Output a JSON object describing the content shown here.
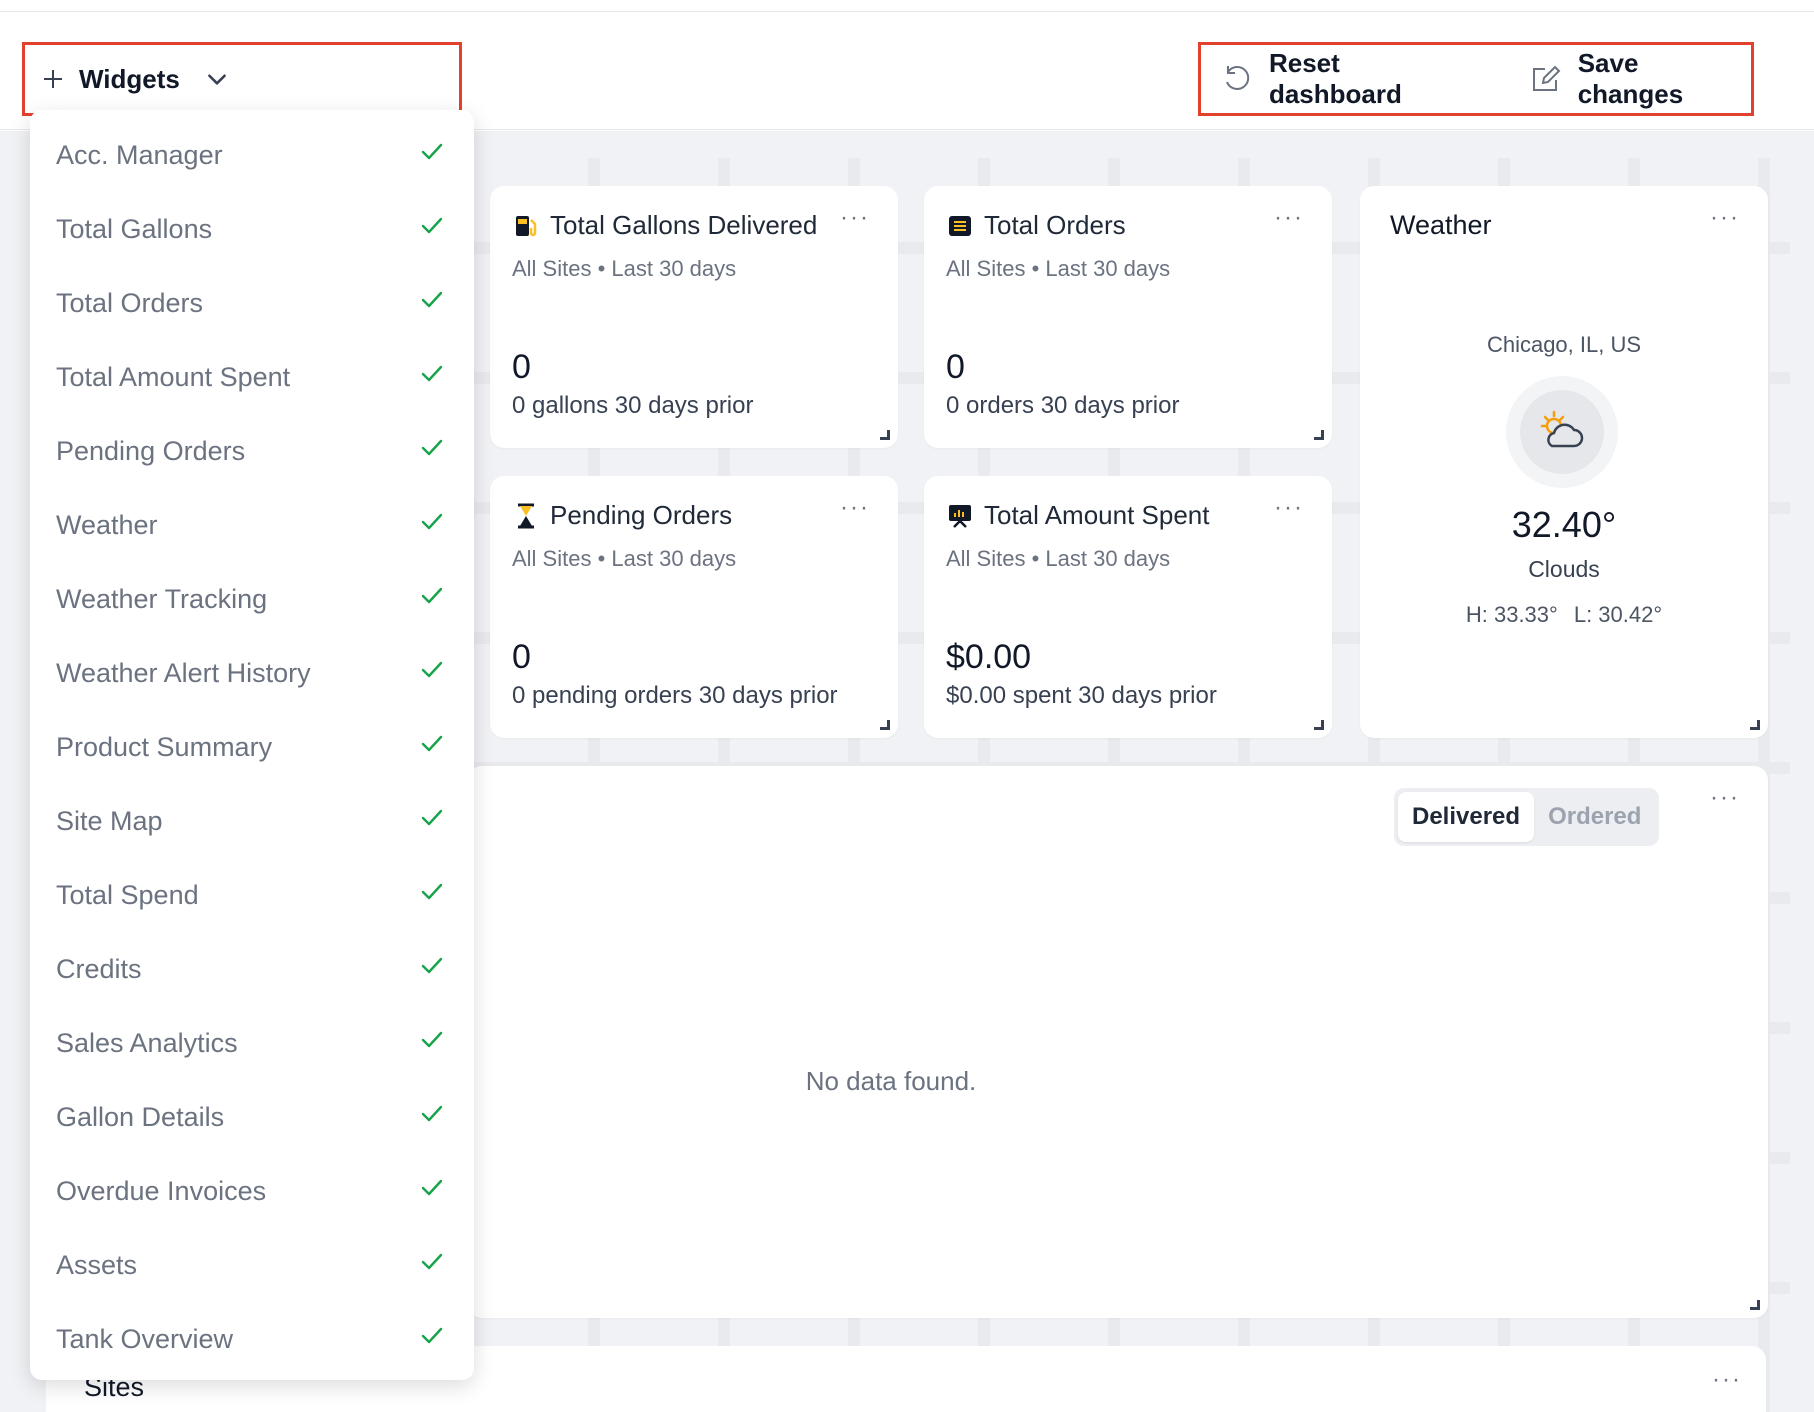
{
  "toolbar": {
    "widgets_label": "Widgets",
    "reset_label": "Reset dashboard",
    "save_label": "Save changes"
  },
  "dropdown": {
    "items": [
      {
        "label": "Acc. Manager",
        "checked": true
      },
      {
        "label": "Total Gallons",
        "checked": true
      },
      {
        "label": "Total Orders",
        "checked": true
      },
      {
        "label": "Total Amount Spent",
        "checked": true
      },
      {
        "label": "Pending Orders",
        "checked": true
      },
      {
        "label": "Weather",
        "checked": true
      },
      {
        "label": "Weather Tracking",
        "checked": true
      },
      {
        "label": "Weather Alert History",
        "checked": true
      },
      {
        "label": "Product Summary",
        "checked": true
      },
      {
        "label": "Site Map",
        "checked": true
      },
      {
        "label": "Total Spend",
        "checked": true
      },
      {
        "label": "Credits",
        "checked": true
      },
      {
        "label": "Sales Analytics",
        "checked": true
      },
      {
        "label": "Gallon Details",
        "checked": true
      },
      {
        "label": "Overdue Invoices",
        "checked": true
      },
      {
        "label": "Assets",
        "checked": true
      },
      {
        "label": "Tank Overview",
        "checked": true
      }
    ]
  },
  "cards": {
    "gallons": {
      "title": "Total Gallons Delivered",
      "subtitle": "All Sites • Last 30 days",
      "value": "0",
      "prior": "0 gallons 30 days prior",
      "icon": "fuel-pump-icon"
    },
    "orders": {
      "title": "Total Orders",
      "subtitle": "All Sites • Last 30 days",
      "value": "0",
      "prior": "0 orders 30 days prior",
      "icon": "list-icon"
    },
    "pending": {
      "title": "Pending Orders",
      "subtitle": "All Sites • Last 30 days",
      "value": "0",
      "prior": "0 pending orders 30 days prior",
      "icon": "hourglass-icon"
    },
    "spent": {
      "title": "Total Amount Spent",
      "subtitle": "All Sites • Last 30 days",
      "value": "$0.00",
      "prior": "$0.00 spent 30 days prior",
      "icon": "presentation-chart-icon"
    },
    "more": "···"
  },
  "weather": {
    "title": "Weather",
    "location": "Chicago, IL, US",
    "temperature": "32.40°",
    "condition": "Clouds",
    "high": "H: 33.33°",
    "low": "L: 30.42°"
  },
  "chart_panel": {
    "toggle": [
      "Delivered",
      "Ordered"
    ],
    "active": "Delivered",
    "empty_text": "No data found."
  },
  "sites": {
    "title": "Sites"
  },
  "colors": {
    "highlight_border": "#e2412d",
    "check": "#16a34a",
    "canvas": "#f1f2f5"
  }
}
